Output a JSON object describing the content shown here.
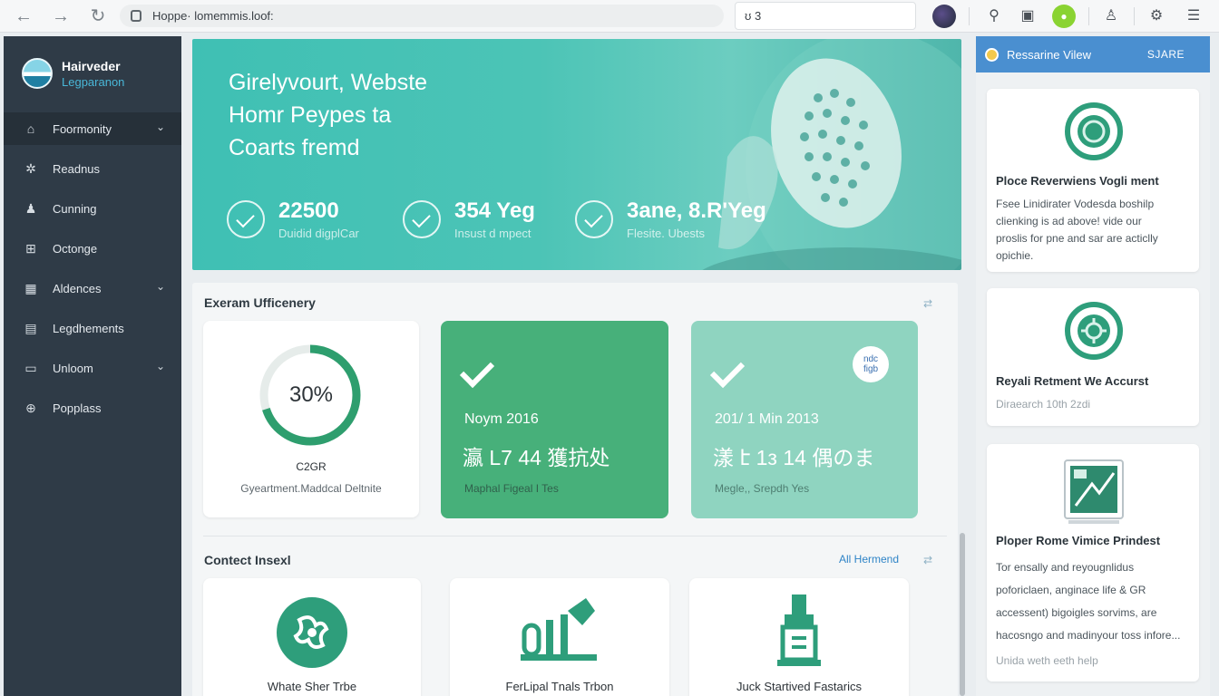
{
  "browser": {
    "url": "Hoppe· lomemmis.loof:",
    "find_value": "ʊ 3",
    "icons": [
      "back-arrow-icon",
      "forward-arrow-icon",
      "reload-icon",
      "lock-icon",
      "profile-icon",
      "key-icon",
      "clipboard-icon",
      "extension-icon",
      "user-icon",
      "gear-icon",
      "menu-icon"
    ]
  },
  "sidebar": {
    "brand_name": "Hairveder",
    "brand_sub": "Legparanon",
    "items": [
      {
        "label": "Foormonity",
        "icon": "home-icon",
        "chevron": true
      },
      {
        "label": "Readnus",
        "icon": "gear-icon",
        "chevron": false
      },
      {
        "label": "Cunning",
        "icon": "user-icon",
        "chevron": false
      },
      {
        "label": "Octonge",
        "icon": "grid-icon",
        "chevron": false
      },
      {
        "label": "Aldences",
        "icon": "calendar-icon",
        "chevron": true
      },
      {
        "label": "Legdhements",
        "icon": "briefcase-icon",
        "chevron": false
      },
      {
        "label": "Unloom",
        "icon": "folder-icon",
        "chevron": true
      },
      {
        "label": "Popplass",
        "icon": "globe-icon",
        "chevron": false
      }
    ]
  },
  "hero": {
    "title": "Girelyvourt, Webste\nHomr Peypes ta\nCoarts fremd",
    "stats": [
      {
        "value": "22500",
        "label": "Duidid digplCar"
      },
      {
        "value": "354 Yeg",
        "label": "Insust d mpect"
      },
      {
        "value": "3ane, 8.R'Yeg",
        "label": "Flesite. Ubests"
      }
    ]
  },
  "efficiency": {
    "title": "Exeram Ufficenery",
    "donut": {
      "percent_label": "30%",
      "percent": 70,
      "caption": "C2GR",
      "sub": "Gyeartment.Maddcal Deltnite"
    },
    "green_card": {
      "line1": "Noym 2016",
      "line2": "瀛 L7 44 獲抗处",
      "line3": "Maphal Figeal I Tes"
    },
    "teal_card": {
      "line1": "201/ 1 Min 2013",
      "line2": "漾  է 1з 14 偶のま",
      "line3": "Megle,, Srepdh Yes",
      "badge": "ndc\nfigb"
    },
    "colors": {
      "green": "#47b07a",
      "teal": "#8fd4c0",
      "accent": "#2e9e7b"
    }
  },
  "content": {
    "title": "Contect Insexl",
    "link": "All Hermend",
    "cards": [
      {
        "label": "Whate Sher Trbe",
        "icon": "pinwheel-icon"
      },
      {
        "label": "FerLipal Tnals Trbon",
        "icon": "factory-icon"
      },
      {
        "label": "Juck Startived Fastarics",
        "icon": "tower-icon"
      }
    ]
  },
  "right_panel": {
    "header": "Ressarine Vilew",
    "share": "SJARE",
    "cards": [
      {
        "title": "Ploce Reverwiens Vogli ment",
        "body": "Fsee Linidirater Vodesda boshilp\nclienking is ad above! vide our\nproslis for pne and sar are acticlly\nopichie.",
        "icon": "target-icon"
      },
      {
        "title": "Reyali Retment We Accurst",
        "meta": "Diraearch 10th 2zdi",
        "icon": "gear-badge-icon"
      },
      {
        "title": "Ploper Rome Vimice Prindest",
        "body": "Tor ensally and reyougnlidus\npoforiclaen, anginace life & GR\naccessent) bigoigles sorvims, are\nhacosngo and madinyour toss infore...",
        "meta": "Unida weth eeth help",
        "icon": "certificate-icon"
      }
    ]
  }
}
